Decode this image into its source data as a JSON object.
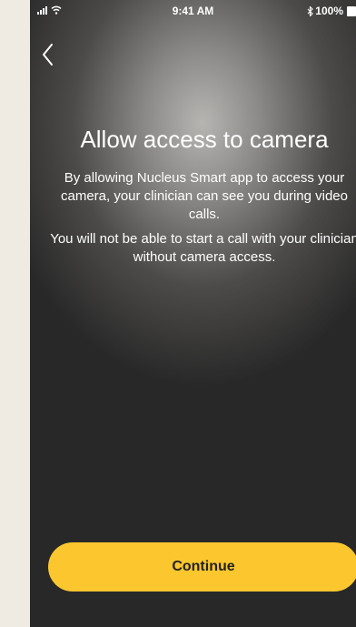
{
  "status_bar": {
    "time": "9:41 AM",
    "battery": "100%"
  },
  "screen": {
    "title": "Allow access to camera",
    "paragraph_1": "By allowing Nucleus Smart app to access your camera, your clinician can see you during video calls.",
    "paragraph_2": "You will not be able to start a call with your clinician without camera access."
  },
  "actions": {
    "continue_label": "Continue"
  },
  "icons": {
    "back": "chevron-left-icon",
    "signal": "cellular-signal-icon",
    "wifi": "wifi-icon",
    "bluetooth": "bluetooth-icon",
    "battery": "battery-icon"
  },
  "colors": {
    "page_background": "#efebe2",
    "continue_button": "#fcc72e",
    "text": "#ffffff"
  }
}
